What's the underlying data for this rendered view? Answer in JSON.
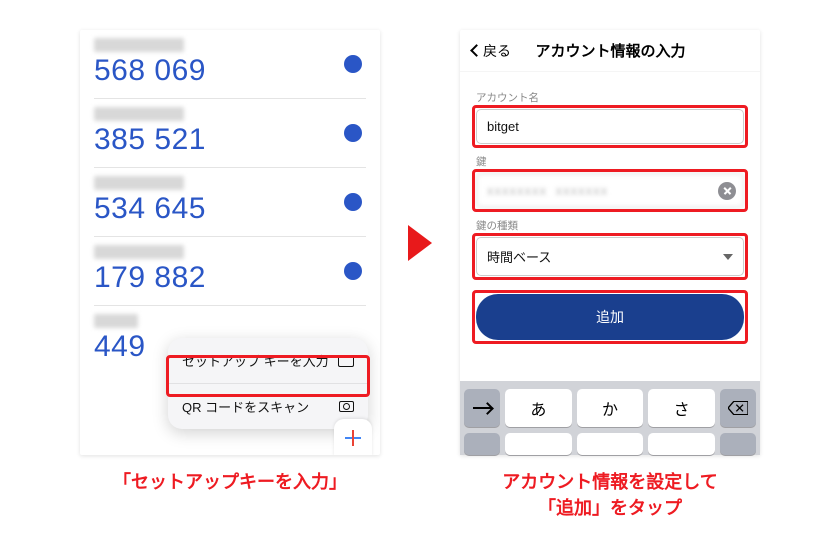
{
  "left": {
    "codes": [
      "568 069",
      "385 521",
      "534 645",
      "179 882",
      "449"
    ],
    "popup": {
      "setup_key": "セットアップ キーを入力",
      "scan_qr": "QR コードをスキャン"
    },
    "caption": "「セットアップキーを入力」"
  },
  "right": {
    "back": "戻る",
    "title": "アカウント情報の入力",
    "labels": {
      "account": "アカウント名",
      "key": "鍵",
      "type": "鍵の種類"
    },
    "values": {
      "account": "bitget",
      "key": "xxxxxxxx xxxxxxx",
      "type": "時間ベース"
    },
    "add": "追加",
    "keys": [
      "あ",
      "か",
      "さ"
    ],
    "caption": "アカウント情報を設定して\n「追加」をタップ"
  }
}
